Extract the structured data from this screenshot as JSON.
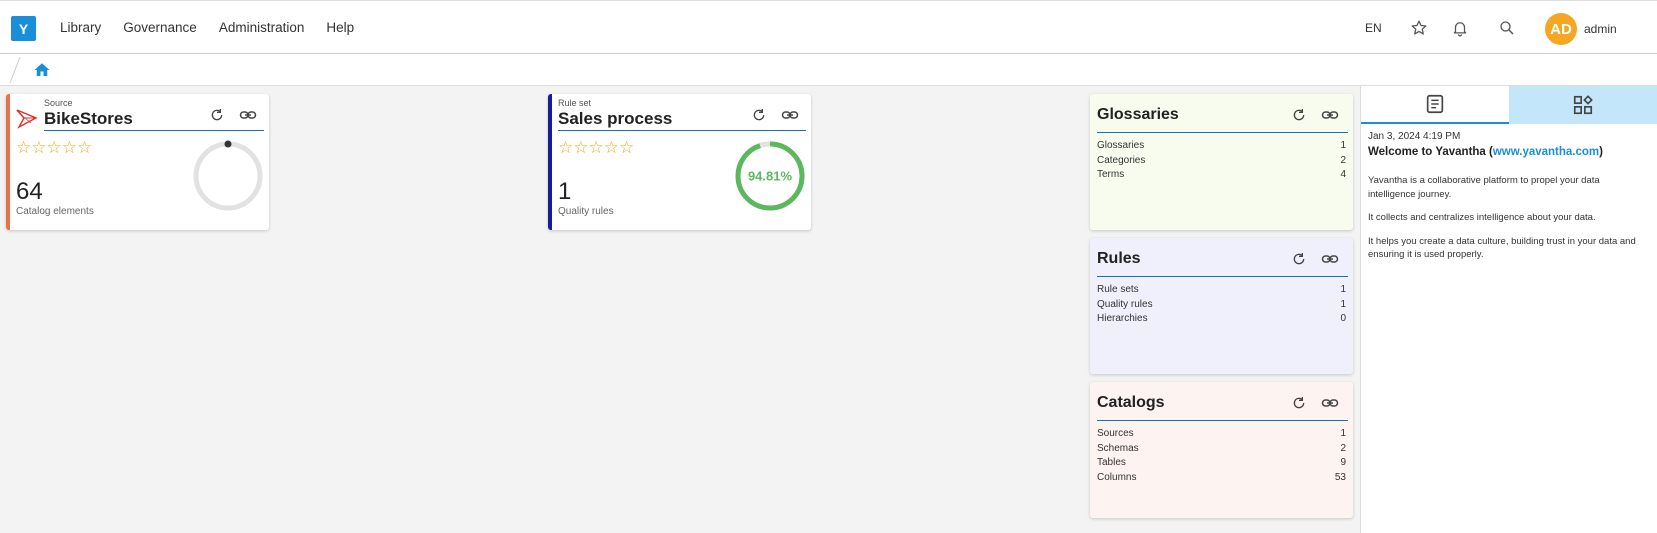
{
  "app": {
    "logo_letter": "Y"
  },
  "nav": {
    "items": [
      "Library",
      "Governance",
      "Administration",
      "Help"
    ]
  },
  "header": {
    "lang": "EN",
    "avatar_initials": "AD",
    "username": "admin"
  },
  "cards": [
    {
      "kind": "Source",
      "title": "BikeStores",
      "stars": "☆☆☆☆☆",
      "count": "64",
      "count_label": "Catalog elements",
      "accent": "#e8734a"
    },
    {
      "kind": "Rule set",
      "title": "Sales process",
      "stars": "☆☆☆☆☆",
      "count": "1",
      "count_label": "Quality rules",
      "accent": "#1a1aa0",
      "quality_percent_label": "94.81%",
      "quality_percent": 94.81,
      "ring_color": "#5cb85c"
    }
  ],
  "summaries": [
    {
      "title": "Glossaries",
      "bg": "#f8fcef",
      "rows": [
        {
          "label": "Glossaries",
          "value": "1"
        },
        {
          "label": "Categories",
          "value": "2"
        },
        {
          "label": "Terms",
          "value": "4"
        }
      ]
    },
    {
      "title": "Rules",
      "bg": "#eff0fb",
      "rows": [
        {
          "label": "Rule sets",
          "value": "1"
        },
        {
          "label": "Quality rules",
          "value": "1"
        },
        {
          "label": "Hierarchies",
          "value": "0"
        }
      ]
    },
    {
      "title": "Catalogs",
      "bg": "#fdf3f1",
      "rows": [
        {
          "label": "Sources",
          "value": "1"
        },
        {
          "label": "Schemas",
          "value": "2"
        },
        {
          "label": "Tables",
          "value": "9"
        },
        {
          "label": "Columns",
          "value": "53"
        }
      ]
    }
  ],
  "news": {
    "date": "Jan 3, 2024 4:19 PM",
    "title_prefix": "Welcome to Yavantha (",
    "title_link": "www.yavantha.com",
    "title_suffix": ")",
    "paragraphs": [
      "Yavantha is a collaborative platform to propel your data intelligence journey.",
      "It collects and centralizes intelligence about your data.",
      "It helps you create a data culture, building trust in your data and ensuring it is used properly."
    ]
  },
  "colors": {
    "brand": "#1a8fd9",
    "rule_line": "#1a6fa8",
    "star": "#f5a623",
    "avatar": "#f5a623"
  }
}
